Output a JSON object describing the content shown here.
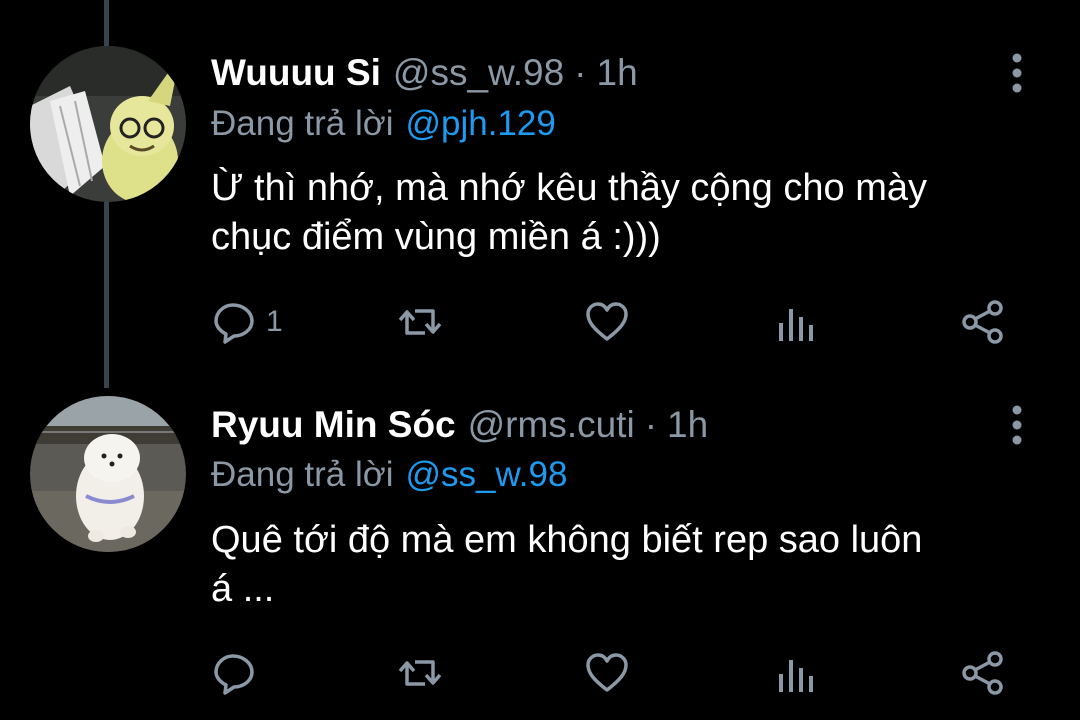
{
  "tweets": [
    {
      "display_name": "Wuuuu Si",
      "handle": "@ss_w.98",
      "separator": "·",
      "time": "1h",
      "replying_prefix": "Đang trả lời",
      "replying_to": "@pjh.129",
      "text_line1": "Ừ thì nhớ, mà nhớ kêu thầy cộng cho mày",
      "text_line2": "chục điểm vùng miền á :)))",
      "reply_count": "1",
      "avatar_icon": "mimikyu-plush-avatar"
    },
    {
      "display_name": "Ryuu Min Sóc",
      "handle": "@rms.cuti",
      "separator": "·",
      "time": "1h",
      "replying_prefix": "Đang trả lời",
      "replying_to": "@ss_w.98",
      "text_line1": "Quê tới độ mà em không biết rep sao luôn",
      "text_line2": "á ...",
      "reply_count": "",
      "avatar_icon": "white-dog-avatar"
    }
  ],
  "colors": {
    "background": "#000000",
    "text": "#ffffff",
    "secondary": "#8b98a5",
    "accent": "#1d9bf0",
    "thread_line": "#38444d"
  },
  "icons": [
    "more-vertical-icon",
    "reply-icon",
    "retweet-icon",
    "like-icon",
    "views-icon",
    "share-icon"
  ]
}
